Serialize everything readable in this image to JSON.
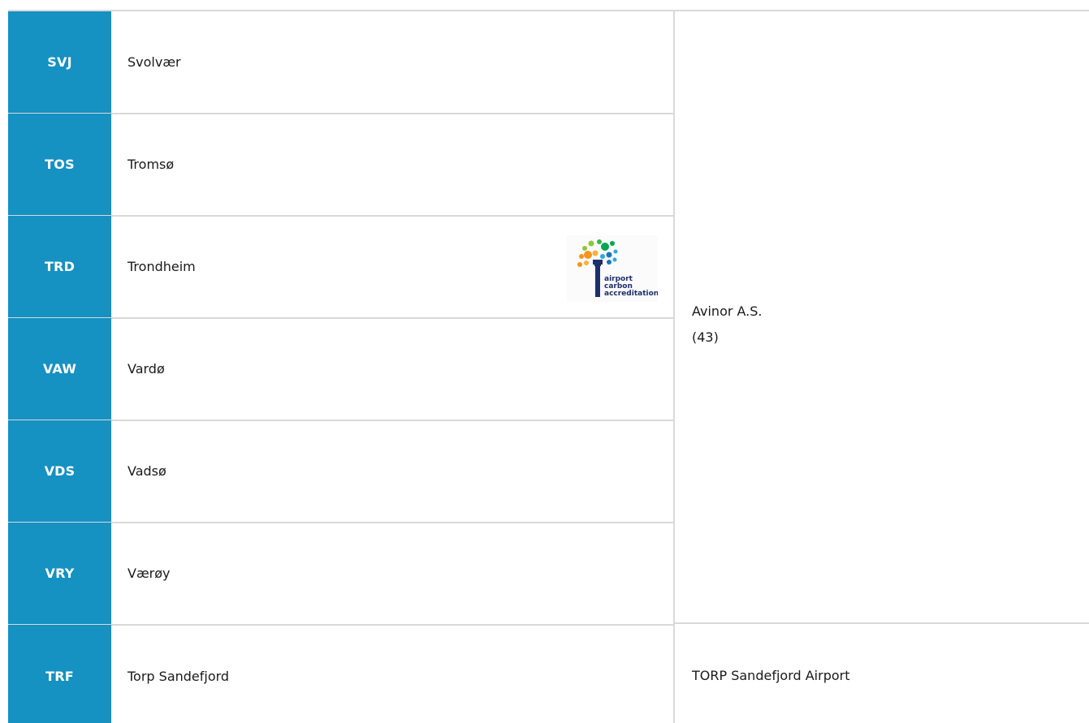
{
  "rows": [
    {
      "code": "SVJ",
      "city": "Svolvær"
    },
    {
      "code": "TOS",
      "city": "Tromsø"
    },
    {
      "code": "TRD",
      "city": "Trondheim"
    },
    {
      "code": "VAW",
      "city": "Vardø"
    },
    {
      "code": "VDS",
      "city": "Vadsø"
    },
    {
      "code": "VRY",
      "værøy_placeholder": "",
      "city": "Værøy"
    },
    {
      "code": "TRF",
      "city": "Torp Sandefjord"
    }
  ],
  "operators": [
    {
      "name": "Avinor A.S.",
      "count": "(43)"
    },
    {
      "name": "TORP Sandefjord Airport"
    }
  ],
  "badge": {
    "icon": "airport-carbon-accreditation-logo",
    "line1": "airport",
    "line2": "carbon",
    "line3": "accreditation"
  },
  "colors": {
    "code_bg": "#1591c2",
    "divider": "#d9d9d9"
  }
}
